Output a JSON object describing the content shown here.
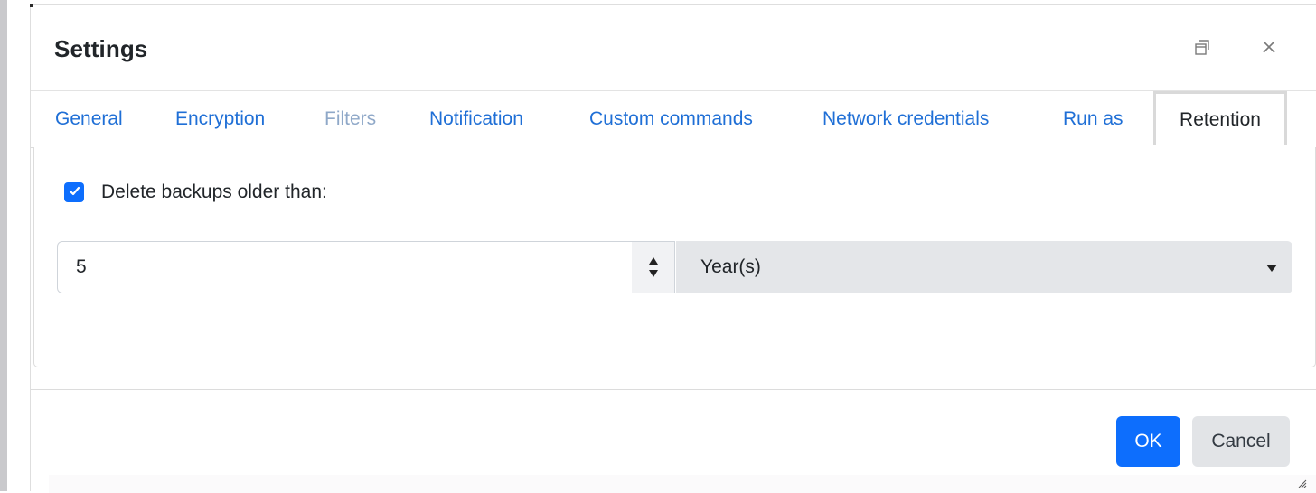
{
  "dialog": {
    "title": "Settings",
    "restore_icon": "restore-window-icon",
    "close_icon": "close-icon"
  },
  "tabs": [
    {
      "label": "General",
      "state": "normal"
    },
    {
      "label": "Encryption",
      "state": "normal"
    },
    {
      "label": "Filters",
      "state": "disabled"
    },
    {
      "label": "Notification",
      "state": "normal"
    },
    {
      "label": "Custom commands",
      "state": "normal"
    },
    {
      "label": "Network credentials",
      "state": "normal"
    },
    {
      "label": "Run as",
      "state": "normal"
    },
    {
      "label": "Retention",
      "state": "active"
    }
  ],
  "retention": {
    "delete_checkbox": {
      "checked": true,
      "label": "Delete backups older than:"
    },
    "age_value": "5",
    "age_unit": "Year(s)"
  },
  "footer": {
    "ok_label": "OK",
    "cancel_label": "Cancel"
  },
  "colors": {
    "accent": "#0d6efd",
    "link": "#1f6fd6",
    "disabled_link": "#8fa8c8",
    "select_bg": "#e4e6e9"
  }
}
